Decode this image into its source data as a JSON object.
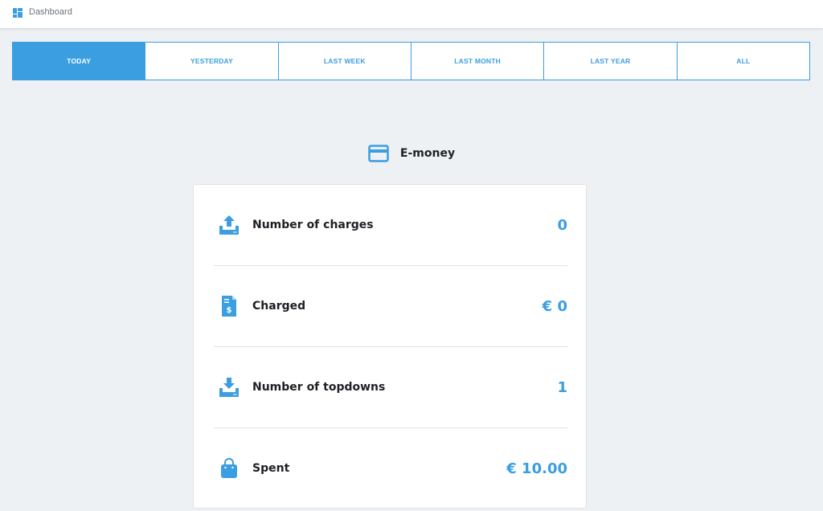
{
  "header": {
    "title": "Dashboard",
    "icon": "dashboard-grid-icon"
  },
  "tabs": [
    {
      "label": "TODAY",
      "active": true
    },
    {
      "label": "YESTERDAY",
      "active": false
    },
    {
      "label": "LAST WEEK",
      "active": false
    },
    {
      "label": "LAST MONTH",
      "active": false
    },
    {
      "label": "LAST YEAR",
      "active": false
    },
    {
      "label": "ALL",
      "active": false
    }
  ],
  "section": {
    "title": "E-money",
    "icon": "credit-card-icon"
  },
  "stats": [
    {
      "label": "Number of charges",
      "value": "0",
      "icon": "upload-tray-icon"
    },
    {
      "label": "Charged",
      "value": "€ 0",
      "icon": "invoice-dollar-icon"
    },
    {
      "label": "Number of topdowns",
      "value": "1",
      "icon": "download-tray-icon"
    },
    {
      "label": "Spent",
      "value": "€ 10.00",
      "icon": "shopping-bag-icon"
    }
  ],
  "colors": {
    "accent": "#3a9ee0",
    "background": "#edf1f4",
    "text": "#1d2024"
  }
}
